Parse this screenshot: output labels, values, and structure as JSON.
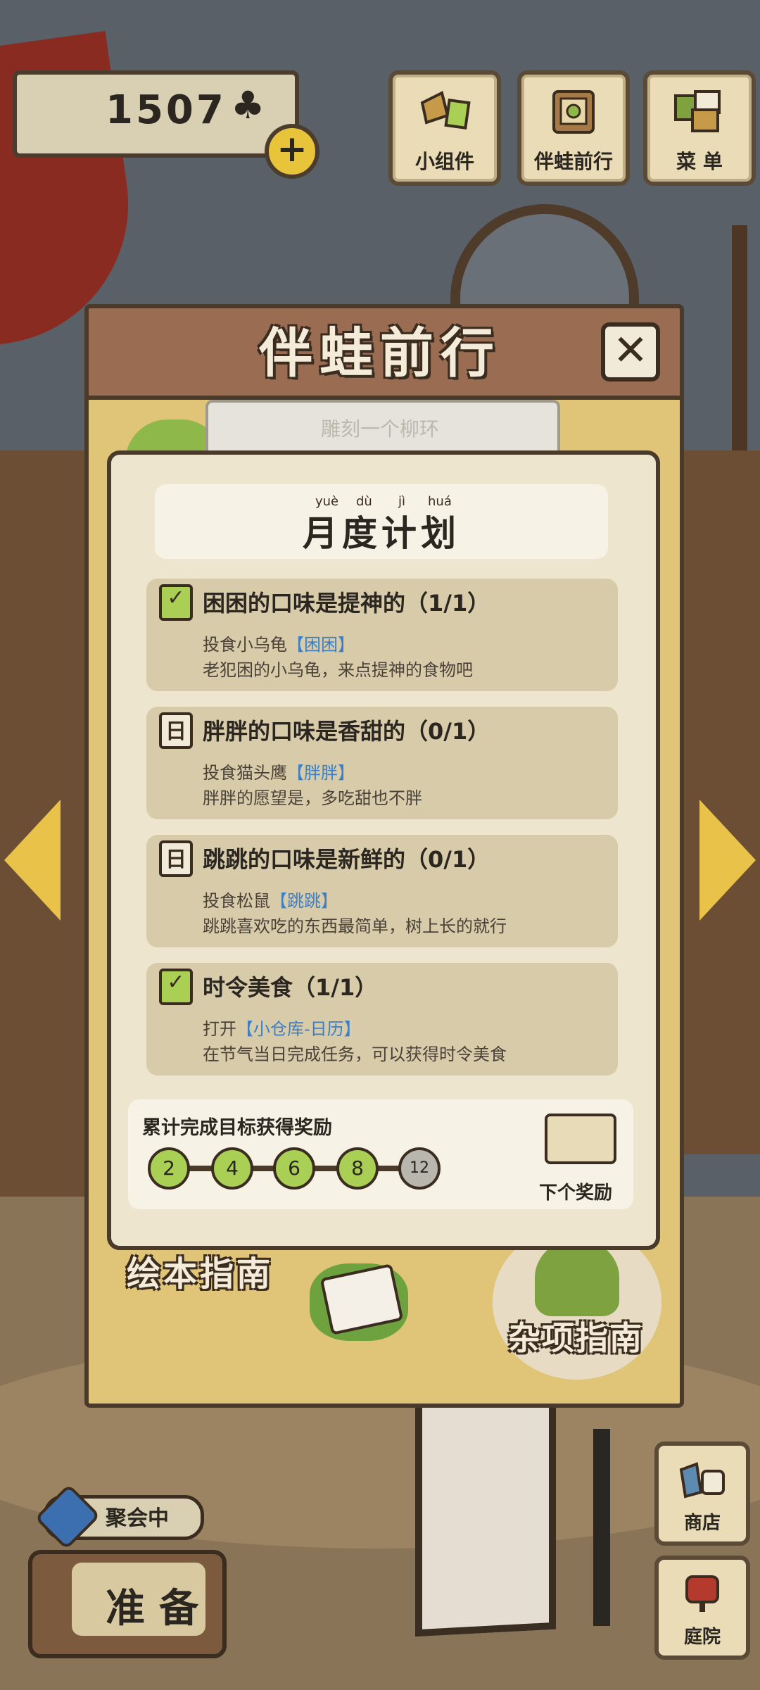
{
  "currency": {
    "amount": "1507",
    "symbol": "♣"
  },
  "top_buttons": [
    {
      "label": "小组件",
      "icon": "widget-icon"
    },
    {
      "label": "伴蛙前行",
      "icon": "journal-icon"
    },
    {
      "label": "菜 单",
      "icon": "menu-icon"
    }
  ],
  "panel": {
    "title": "伴蛙前行",
    "scroll_text": "雕刻一个柳环",
    "guide_left": "绘本指南",
    "guide_right": "杂项指南"
  },
  "card": {
    "title": "月度计划",
    "pinyin": [
      "yuè",
      "dù",
      "jì",
      "huá"
    ]
  },
  "tasks": [
    {
      "title": "困困的口味是提神的（1/1）",
      "line1_prefix": "投食小乌龟",
      "line1_tag": "【困困】",
      "line2": "老犯困的小乌龟，来点提神的食物吧",
      "done": true
    },
    {
      "title": "胖胖的口味是香甜的（0/1）",
      "line1_prefix": "投食猫头鹰",
      "line1_tag": "【胖胖】",
      "line2": "胖胖的愿望是，多吃甜也不胖",
      "done": false
    },
    {
      "title": "跳跳的口味是新鲜的（0/1）",
      "line1_prefix": "投食松鼠",
      "line1_tag": "【跳跳】",
      "line2": "跳跳喜欢吃的东西最简单，树上长的就行",
      "done": false
    },
    {
      "title": "时令美食（1/1）",
      "line1_prefix": "打开",
      "line1_tag": "【小仓库-日历】",
      "line2": "在节气当日完成任务，可以获得时令美食",
      "done": true
    }
  ],
  "reward": {
    "label": "累计完成目标获得奖励",
    "milestones": [
      "2",
      "4",
      "6",
      "8",
      "12"
    ],
    "milestones_reached": 4,
    "next_label": "下个奖励"
  },
  "bottom": {
    "party_label": "聚会中",
    "prepare_label": "准备",
    "shop_label": "商店",
    "yard_label": "庭院"
  },
  "colors": {
    "accent_green": "#a9cf54",
    "link_blue": "#3c7fc4",
    "panel_yellow": "#e0c578",
    "header_brown": "#9a6c52"
  }
}
